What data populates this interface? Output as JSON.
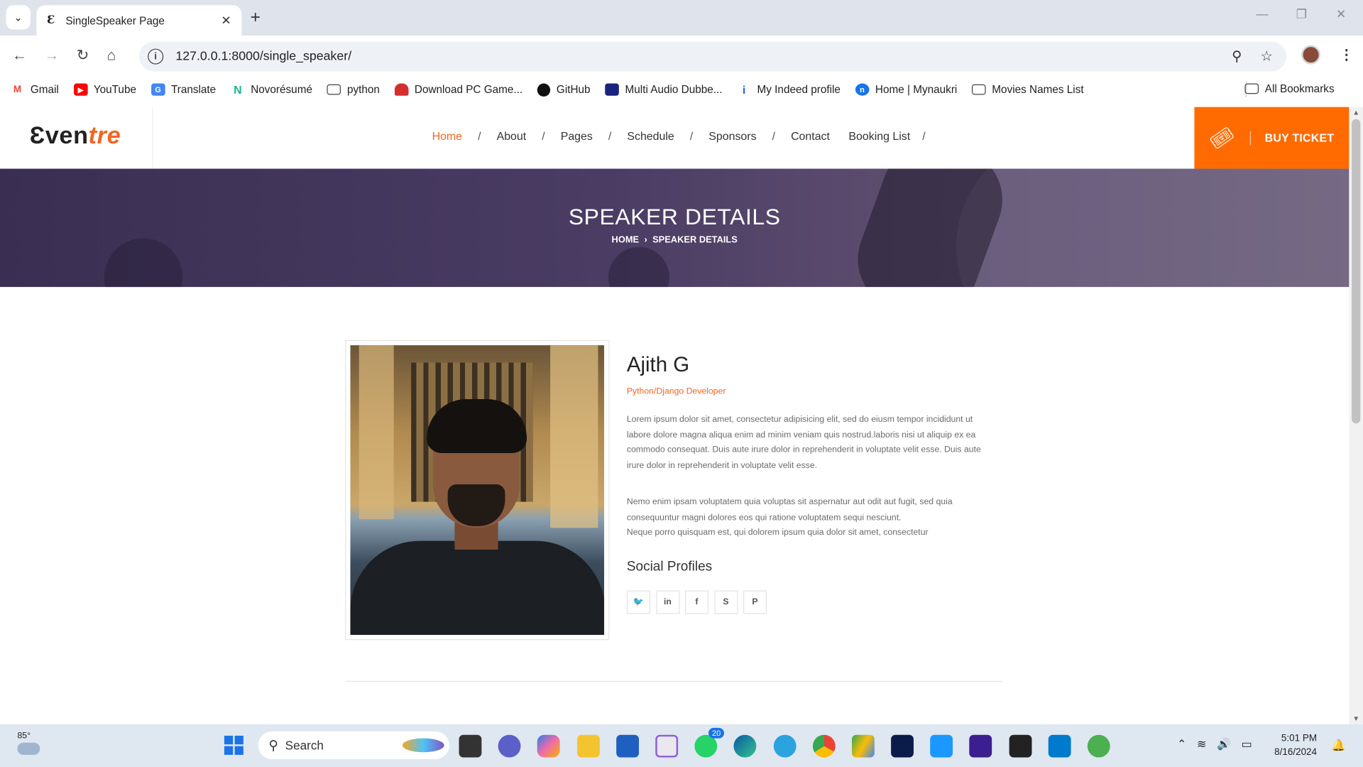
{
  "browser": {
    "tab_title": "SingleSpeaker Page",
    "tab_favicon": "Ɛ",
    "url": "127.0.0.1:8000/single_speaker/",
    "bookmarks": [
      {
        "label": "Gmail",
        "icon": "gmail-icon",
        "color": "#ea4335"
      },
      {
        "label": "YouTube",
        "icon": "youtube-icon",
        "color": "#ff0000"
      },
      {
        "label": "Translate",
        "icon": "translate-icon",
        "color": "#4285f4"
      },
      {
        "label": "Novorésumé",
        "icon": "novoresume-icon",
        "color": "#1ab394"
      },
      {
        "label": "python",
        "icon": "folder-icon",
        "color": "#444444"
      },
      {
        "label": "Download PC Game...",
        "icon": "game-icon",
        "color": "#d32f2f"
      },
      {
        "label": "GitHub",
        "icon": "github-icon",
        "color": "#111111"
      },
      {
        "label": "Multi Audio Dubbe...",
        "icon": "video-icon",
        "color": "#1a237e"
      },
      {
        "label": "My Indeed profile",
        "icon": "indeed-icon",
        "color": "#2164f3"
      },
      {
        "label": "Home | Mynaukri",
        "icon": "naukri-icon",
        "color": "#1a73e8"
      },
      {
        "label": "Movies Names List",
        "icon": "folder-icon",
        "color": "#444444"
      }
    ],
    "all_bookmarks": "All Bookmarks"
  },
  "site": {
    "logo_main": "Ɛven",
    "logo_accent": "tre",
    "menu": [
      "Home",
      "About",
      "Pages",
      "Schedule",
      "Sponsors",
      "Contact",
      "Booking List"
    ],
    "active_menu": "Home",
    "buy_ticket": "BUY TICKET",
    "accent_color": "#ff6b00"
  },
  "banner": {
    "title": "SPEAKER DETAILS",
    "crumb_home": "HOME",
    "crumb_current": "SPEAKER DETAILS"
  },
  "speaker": {
    "name": "Ajith G",
    "role": "Python/Django Developer",
    "bio_1": "Lorem ipsum dolor sit amet, consectetur adipisicing elit, sed do eiusm tempor incididunt ut labore dolore magna aliqua enim ad minim veniam quis nostrud.laboris nisi ut aliquip ex ea commodo consequat. Duis aute irure dolor in reprehenderit in voluptate velit esse. Duis aute irure dolor in reprehenderit in voluptate velit esse.",
    "bio_2": "Nemo enim ipsam voluptatem quia voluptas sit aspernatur aut odit aut fugit, sed quia consequuntur magni dolores eos qui ratione voluptatem sequi nesciunt.",
    "bio_3": "Neque porro quisquam est, qui dolorem ipsum quia dolor sit amet, consectetur",
    "social_heading": "Social Profiles",
    "socials": [
      "twitter-icon",
      "linkedin-icon",
      "facebook-icon",
      "skype-icon",
      "pinterest-icon"
    ]
  },
  "taskbar": {
    "weather": "85°",
    "search": "Search",
    "whatsapp_badge": "20",
    "time": "5:01 PM",
    "date": "8/16/2024"
  }
}
